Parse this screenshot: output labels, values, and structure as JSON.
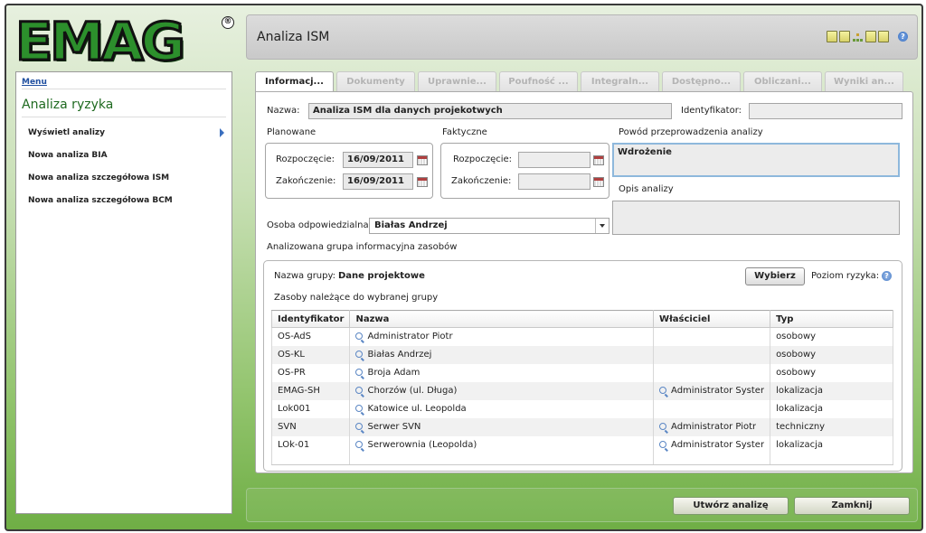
{
  "logo": {
    "text": "EMAG",
    "registered": "®"
  },
  "header": {
    "title": "Analiza ISM"
  },
  "sidebar": {
    "menu_label": "Menu",
    "title": "Analiza ryzyka",
    "items": [
      {
        "label": "Wyświetl analizy"
      },
      {
        "label": "Nowa analiza BIA"
      },
      {
        "label": "Nowa analiza szczegółowa ISM"
      },
      {
        "label": "Nowa analiza szczegółowa BCM"
      }
    ]
  },
  "tabs": [
    {
      "label": "Informacj...",
      "active": true
    },
    {
      "label": "Dokumenty",
      "active": false
    },
    {
      "label": "Uprawnie...",
      "active": false
    },
    {
      "label": "Poufność ...",
      "active": false
    },
    {
      "label": "Integraln...",
      "active": false
    },
    {
      "label": "Dostępno...",
      "active": false
    },
    {
      "label": "Obliczani...",
      "active": false
    },
    {
      "label": "Wyniki an...",
      "active": false
    }
  ],
  "form": {
    "name_label": "Nazwa:",
    "name_value": "Analiza ISM dla danych projekotwych",
    "id_label": "Identyfikator:",
    "id_value": "",
    "planned_label": "Planowane",
    "actual_label": "Faktyczne",
    "start_label": "Rozpoczęcie:",
    "end_label": "Zakończenie:",
    "planned_start": "16/09/2011",
    "planned_end": "16/09/2011",
    "actual_start": "",
    "actual_end": "",
    "reason_label": "Powód przeprowadzenia analizy",
    "reason_value": "Wdrożenie",
    "description_label": "Opis analizy",
    "description_value": "",
    "owner_label": "Osoba odpowiedzialna:",
    "owner_value": "Białas Andrzej",
    "group_section_label": "Analizowana grupa informacyjna zasobów"
  },
  "group": {
    "name_label": "Nazwa grupy:",
    "name_value": "Dane projektowe",
    "select_button": "Wybierz",
    "risk_label": "Poziom ryzyka:",
    "assets_label": "Zasoby należące do wybranej grupy",
    "columns": [
      "Identyfikator",
      "Nazwa",
      "Właściciel",
      "Typ"
    ],
    "rows": [
      {
        "id": "OS-AdS",
        "name": "Administrator Piotr",
        "owner": "",
        "type": "osobowy"
      },
      {
        "id": "OS-KL",
        "name": "Białas Andrzej",
        "owner": "",
        "type": "osobowy"
      },
      {
        "id": "OS-PR",
        "name": "Broja Adam",
        "owner": "",
        "type": "osobowy"
      },
      {
        "id": "EMAG-SH",
        "name": "Chorzów (ul. Długa)",
        "owner": "Administrator Syster",
        "type": "lokalizacja"
      },
      {
        "id": "Lok001",
        "name": "Katowice ul. Leopolda",
        "owner": "",
        "type": "lokalizacja"
      },
      {
        "id": "SVN",
        "name": "Serwer SVN",
        "owner": "Administrator Piotr",
        "type": "techniczny"
      },
      {
        "id": "LOk-01",
        "name": "Serwerownia (Leopolda)",
        "owner": "Administrator Syster",
        "type": "lokalizacja"
      }
    ]
  },
  "footer": {
    "create_button": "Utwórz analizę",
    "close_button": "Zamknij"
  },
  "colors": {
    "brand_green": "#2c8f2c",
    "background_green": "#6fae45",
    "link_blue": "#1f4f9f",
    "focus_border": "#8eb8dc"
  },
  "icons": [
    "calendar-icon",
    "magnifier-icon",
    "help-icon",
    "info-icon",
    "chevron-right-icon",
    "dropdown-arrow-icon",
    "toolbar-export-icon",
    "sitemap-icon"
  ]
}
